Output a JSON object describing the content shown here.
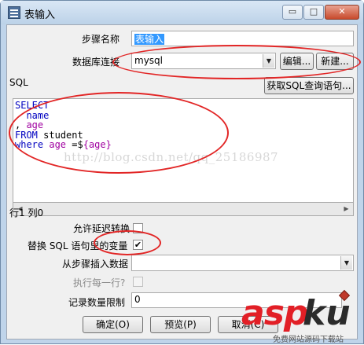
{
  "window": {
    "title": "表输入",
    "minimize_glyph": "▭",
    "maximize_glyph": "□",
    "close_glyph": "✕"
  },
  "form": {
    "step_name_label": "步骤名称",
    "step_name_value": "表输入",
    "connection_label": "数据库连接",
    "connection_value": "mysql",
    "edit_button": "编辑...",
    "new_button": "新建...",
    "sql_label": "SQL",
    "get_sql_button": "获取SQL查询语句...",
    "sql_lines": {
      "l1": "SELECT",
      "l2_ident": "name",
      "l3_prefix": ", ",
      "l3_ident": "age",
      "l4_kw": "FROM",
      "l4_ident": "student",
      "l5_kw": "where",
      "l5_ident": "age",
      "l5_op": " =$",
      "l5_var": "{age}"
    },
    "cursor_position": "行1 列0",
    "lazy_conversion_label": "允许延迟转换",
    "lazy_conversion_checked": false,
    "replace_vars_label": "替换 SQL 语句里的变量",
    "replace_vars_checked": true,
    "insert_from_step_label": "从步骤插入数据",
    "insert_from_step_value": "",
    "execute_each_row_label": "执行每一行?",
    "execute_each_row_checked": false,
    "limit_label": "记录数量限制",
    "limit_value": "0"
  },
  "buttons": {
    "ok": "确定(O)",
    "preview": "预览(P)",
    "cancel": "取消(C)"
  },
  "overlay": {
    "watermark": "http://blog.csdn.net/qq_25186987",
    "logo_asp": "asp",
    "logo_ku": "ku",
    "logo_sub": "免费网站源码下载站"
  },
  "colors": {
    "annotation_red": "#e22626",
    "sql_keyword": "#0000c0",
    "sql_variable": "#a000a0",
    "selection_blue": "#3399ff"
  }
}
